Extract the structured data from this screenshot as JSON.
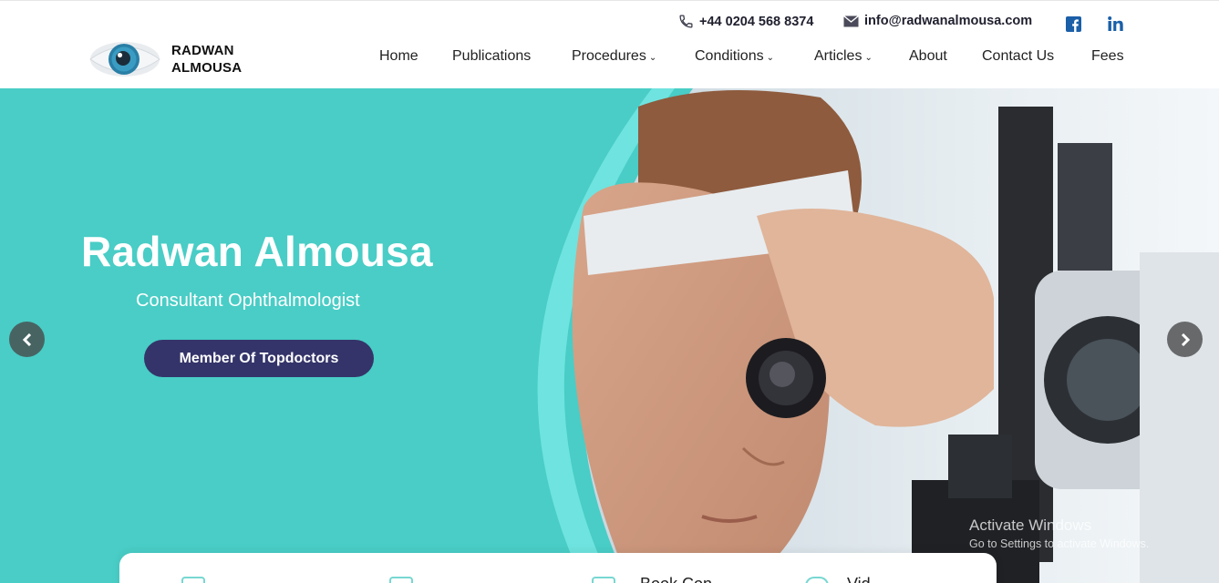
{
  "header": {
    "phone": "+44 0204 568 8374",
    "email": "info@radwanalmousa.com",
    "logo_line1": "RADWAN",
    "logo_line2": "ALMOUSA",
    "social": [
      "facebook-icon",
      "linkedin-icon"
    ]
  },
  "nav": {
    "items": [
      {
        "label": "Home",
        "dropdown": false
      },
      {
        "label": "Publications",
        "dropdown": false
      },
      {
        "label": "Procedures",
        "dropdown": true
      },
      {
        "label": "Conditions",
        "dropdown": true
      },
      {
        "label": "Articles",
        "dropdown": true
      },
      {
        "label": "About",
        "dropdown": false
      },
      {
        "label": "Contact Us",
        "dropdown": false
      },
      {
        "label": "Fees",
        "dropdown": false
      }
    ]
  },
  "hero": {
    "title": "Radwan Almousa",
    "subtitle": "Consultant Ophthalmologist",
    "button": "Member Of Topdoctors"
  },
  "watermark": {
    "title": "Activate Windows",
    "subtitle": "Go to Settings to activate Windows."
  },
  "card": {
    "items": [
      "Book Con",
      "Vid"
    ]
  },
  "colors": {
    "teal": "#49cdc6",
    "navy_button": "#34346a",
    "social_blue": "#1a5fa8"
  }
}
